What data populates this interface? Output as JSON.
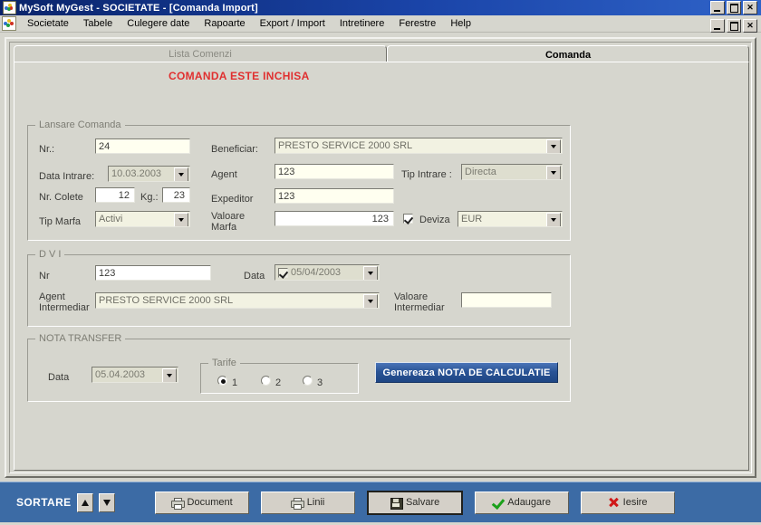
{
  "window": {
    "title": "MySoft MyGest  - SOCIETATE - [Comanda Import]",
    "app_icon": "mygest-logo-icon",
    "minimize_label": "_",
    "maximize_label": "❐",
    "close_label": "✕"
  },
  "menu": {
    "items": [
      {
        "label": "Societate"
      },
      {
        "label": "Tabele"
      },
      {
        "label": "Culegere date"
      },
      {
        "label": "Rapoarte"
      },
      {
        "label": "Export / Import"
      },
      {
        "label": "Intretinere"
      },
      {
        "label": "Ferestre"
      },
      {
        "label": "Help"
      }
    ]
  },
  "tabs": [
    {
      "label": "Lista Comenzi",
      "active": false
    },
    {
      "label": "Comanda",
      "active": true
    }
  ],
  "status": {
    "warning_text": "COMANDA ESTE INCHISA",
    "warning_color": "#e03030"
  },
  "lansare": {
    "caption": "Lansare Comanda",
    "nr_label": "Nr.:",
    "nr_value": "24",
    "data_intrare_label": "Data Intrare:",
    "data_intrare_value": "10.03.2003",
    "nr_colete_label": "Nr. Colete",
    "nr_colete_value": "12",
    "kg_label": "Kg.:",
    "kg_value": "23",
    "tip_marfa_label": "Tip Marfa",
    "tip_marfa_value": "Activi",
    "beneficiar_label": "Beneficiar:",
    "beneficiar_value": "PRESTO SERVICE  2000 SRL",
    "agent_label": "Agent",
    "agent_value": "123",
    "expeditor_label": "Expeditor",
    "expeditor_value": "123",
    "valoare_marfa_label": "Valoare\nMarfa",
    "valoare_marfa_line1": "Valoare",
    "valoare_marfa_line2": "Marfa",
    "valoare_marfa_value": "123",
    "tip_intrare_label": "Tip Intrare :",
    "tip_intrare_value": "Directa",
    "deviza_label": "Deviza",
    "deviza_checked": true,
    "deviza_value": "EUR"
  },
  "dvi": {
    "caption": "D V I",
    "nr_label": "Nr",
    "nr_value": "123",
    "data_label": "Data",
    "data_value": "05/04/2003",
    "data_checked": true,
    "agent_intermediar_line1": "Agent",
    "agent_intermediar_line2": "Intermediar",
    "agent_intermediar_value": "PRESTO SERVICE  2000 SRL",
    "valoare_intermediar_line1": "Valoare",
    "valoare_intermediar_line2": "Intermediar",
    "valoare_intermediar_value": ""
  },
  "nota_transfer": {
    "caption": "NOTA TRANSFER",
    "data_label": "Data",
    "data_value": "05.04.2003",
    "tarife_caption": "Tarife",
    "tarife_options": [
      {
        "label": "1",
        "selected": true
      },
      {
        "label": "2",
        "selected": false
      },
      {
        "label": "3",
        "selected": false
      }
    ],
    "generate_button": "Genereaza NOTA DE CALCULATIE",
    "generate_button_color": "#2a5496"
  },
  "toolbar": {
    "sortare_label": "SORTARE",
    "sort_up_icon": "arrow-up-icon",
    "sort_down_icon": "arrow-down-icon",
    "background_color": "#3c6ba5",
    "buttons": [
      {
        "label": "Document",
        "icon": "printer-icon"
      },
      {
        "label": "Linii",
        "icon": "printer-icon"
      },
      {
        "label": "Salvare",
        "icon": "floppy-disk-icon"
      },
      {
        "label": "Adaugare",
        "icon": "check-icon"
      },
      {
        "label": "Iesire",
        "icon": "x-icon"
      }
    ]
  }
}
